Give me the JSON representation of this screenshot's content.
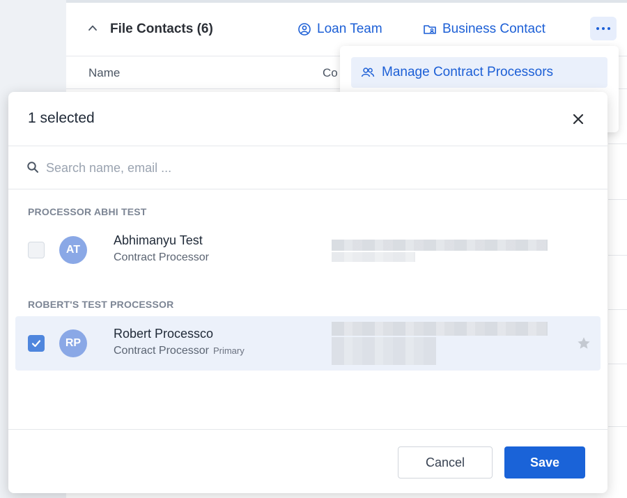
{
  "background": {
    "section_title": "File Contacts (6)",
    "loan_team_label": "Loan Team",
    "business_contact_label": "Business Contact",
    "columns": [
      "Name",
      "Co"
    ]
  },
  "dropdown": {
    "manage_label": "Manage Contract Processors"
  },
  "modal": {
    "title": "1 selected",
    "search_placeholder": "Search name, email ...",
    "groups": [
      {
        "label": "PROCESSOR ABHI TEST",
        "contacts": [
          {
            "initials": "AT",
            "name": "Abhimanyu Test",
            "role": "Contract Processor",
            "tag": "",
            "checked": false
          }
        ]
      },
      {
        "label": "ROBERT'S TEST PROCESSOR",
        "contacts": [
          {
            "initials": "RP",
            "name": "Robert Processco",
            "role": "Contract Processor",
            "tag": "Primary",
            "checked": true
          }
        ]
      }
    ],
    "cancel_label": "Cancel",
    "save_label": "Save"
  },
  "colors": {
    "accent": "#1a63d8",
    "link": "#1c5fd6",
    "avatar": "#8aa8e6",
    "selected_row": "#ecf1fa",
    "checkbox_checked": "#4f86dd"
  },
  "icons": [
    "chevron-up-icon",
    "user-group-icon",
    "folder-contact-icon",
    "more-horizontal-icon",
    "users-icon",
    "close-icon",
    "search-icon",
    "checkmark-icon",
    "star-icon"
  ]
}
